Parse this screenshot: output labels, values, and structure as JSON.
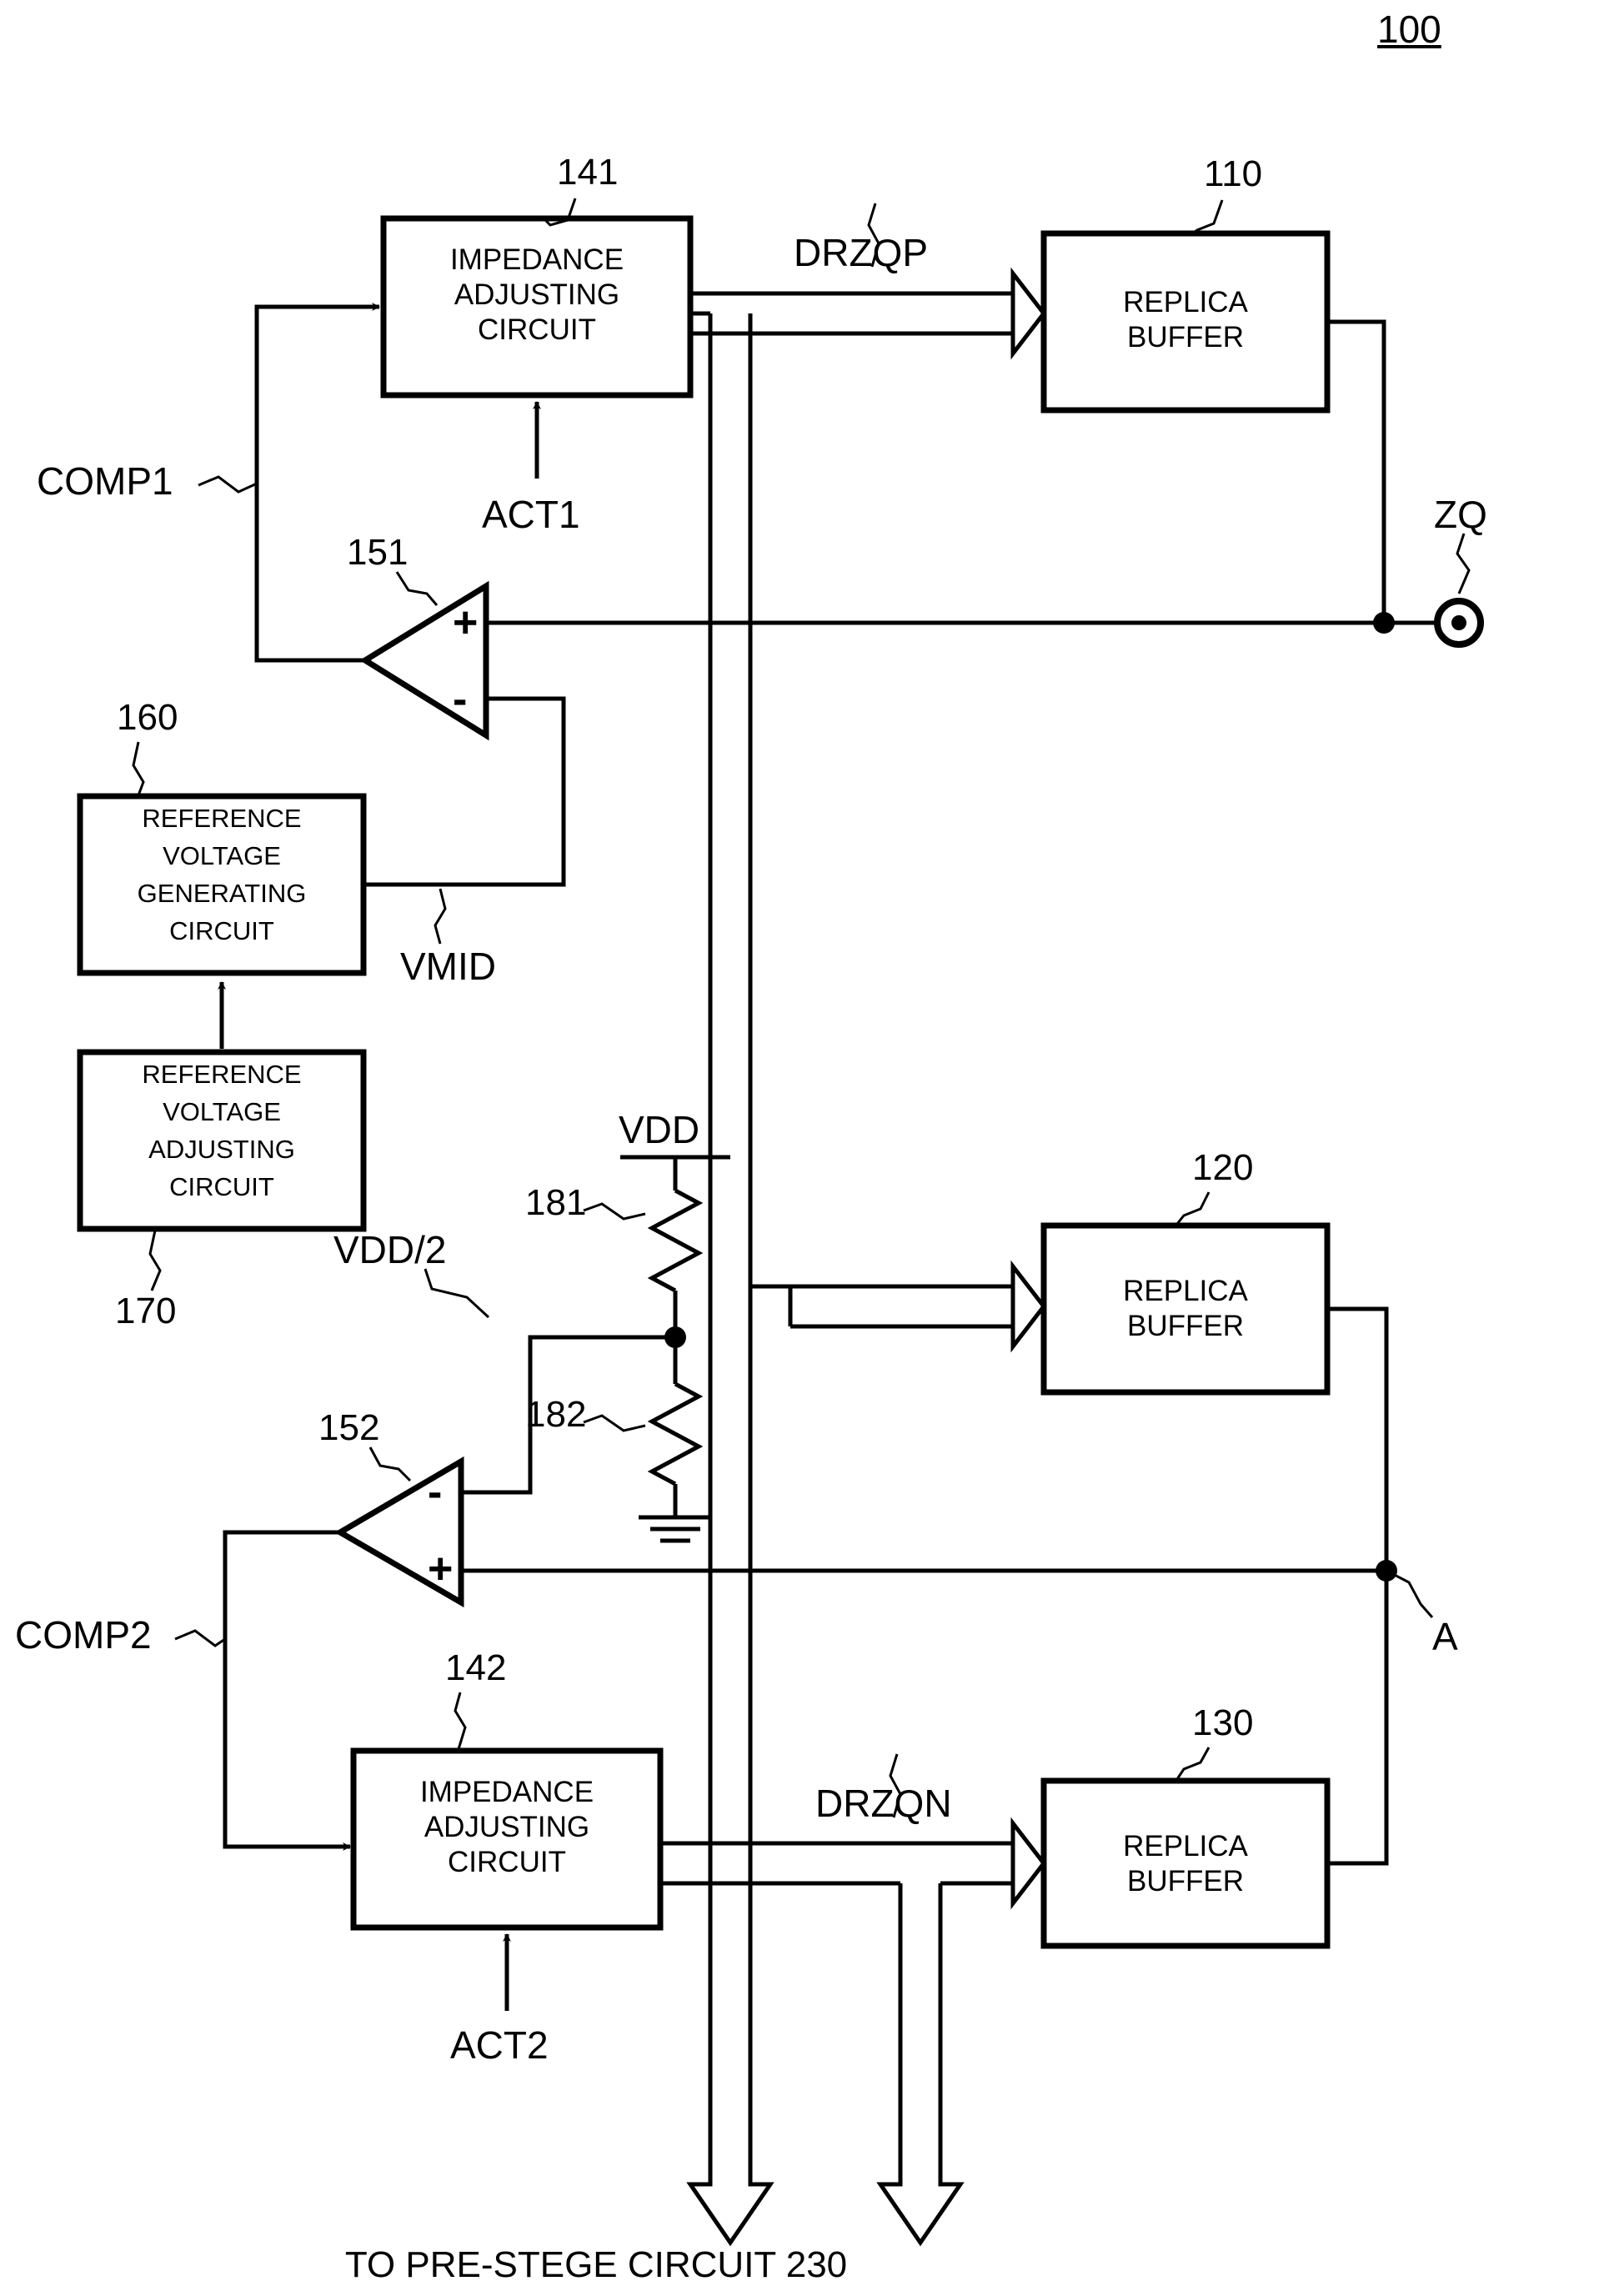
{
  "figure": {
    "number": "100"
  },
  "blocks": [
    {
      "id": "iac1",
      "ref": "141",
      "lines": [
        "IMPEDANCE",
        "ADJUSTING",
        "CIRCUIT"
      ]
    },
    {
      "id": "rb110",
      "ref": "110",
      "lines": [
        "REPLICA",
        "BUFFER"
      ]
    },
    {
      "id": "rvgc",
      "ref": "160",
      "lines": [
        "REFERENCE",
        "VOLTAGE",
        "GENERATING",
        "CIRCUIT"
      ]
    },
    {
      "id": "rvac",
      "ref": "170",
      "lines": [
        "REFERENCE",
        "VOLTAGE",
        "ADJUSTING",
        "CIRCUIT"
      ]
    },
    {
      "id": "rb120",
      "ref": "120",
      "lines": [
        "REPLICA",
        "BUFFER"
      ]
    },
    {
      "id": "iac2",
      "ref": "142",
      "lines": [
        "IMPEDANCE",
        "ADJUSTING",
        "CIRCUIT"
      ]
    },
    {
      "id": "rb130",
      "ref": "130",
      "lines": [
        "REPLICA",
        "BUFFER"
      ]
    }
  ],
  "comparators": [
    {
      "ref": "151",
      "top_input": "+",
      "bottom_input": "-"
    },
    {
      "ref": "152",
      "top_input": "-",
      "bottom_input": "+"
    }
  ],
  "resistors": [
    {
      "ref": "181"
    },
    {
      "ref": "182"
    }
  ],
  "signals": {
    "comp1": "COMP1",
    "comp2": "COMP2",
    "act1": "ACT1",
    "act2": "ACT2",
    "drzqp": "DRZQP",
    "drzqn": "DRZQN",
    "vmid": "VMID",
    "vdd": "VDD",
    "vdd_half": "VDD/2",
    "zq": "ZQ",
    "node_a": "A"
  },
  "caption": "TO PRE-STEGE CIRCUIT 230",
  "colors": {
    "ink": "#000000",
    "paper": "#ffffff"
  }
}
